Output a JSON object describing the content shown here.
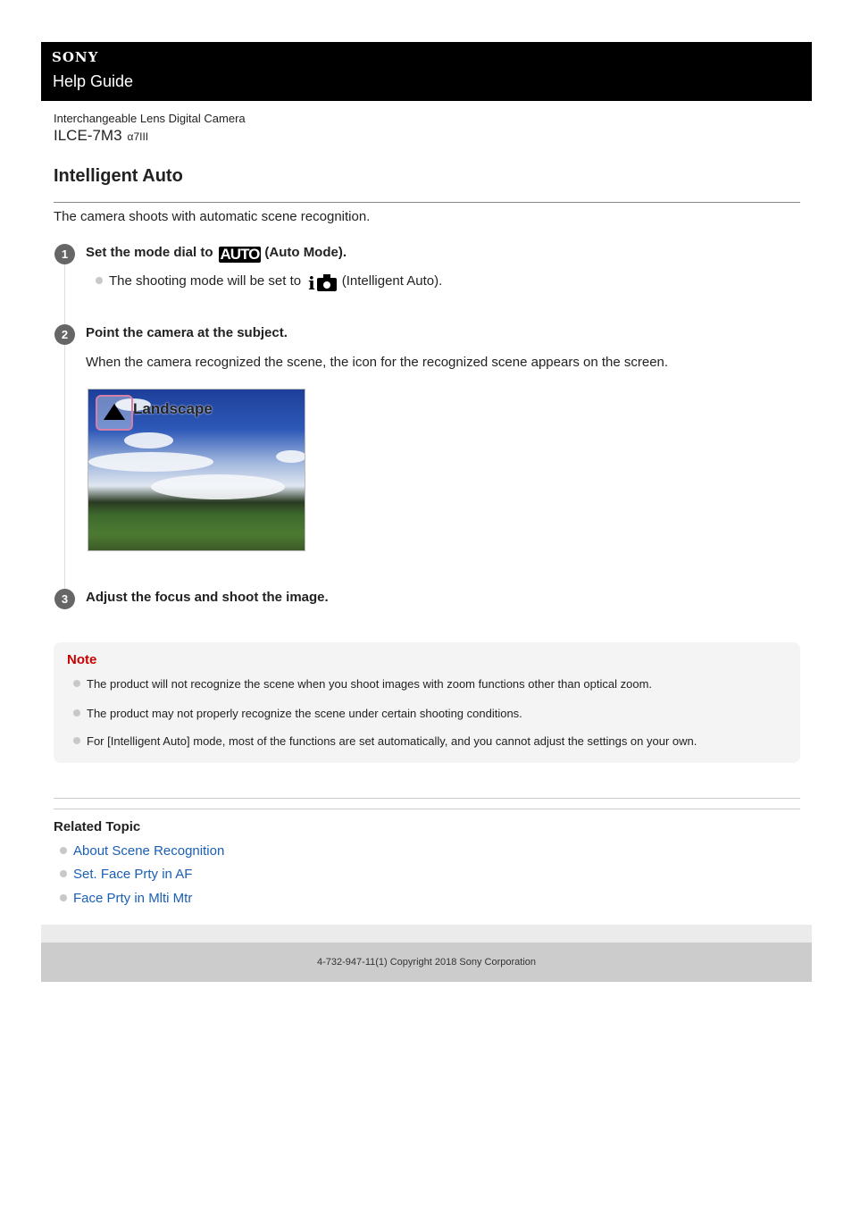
{
  "header": {
    "brand": "SONY",
    "title": "Help Guide"
  },
  "product": {
    "category": "Interchangeable Lens Digital Camera",
    "model": "ILCE-7M3",
    "alpha_name": "α7III"
  },
  "page": {
    "title": "Intelligent Auto",
    "intro": "The camera shoots with automatic scene recognition."
  },
  "steps": [
    {
      "number": "1",
      "title_before": "Set the mode dial to",
      "icon": "auto-mode-icon",
      "icon_text": "AUTO",
      "title_after": "(Auto Mode).",
      "sub_before": "The shooting mode will be set to",
      "sub_icon": "intelligent-auto-icon",
      "sub_after": "(Intelligent Auto)."
    },
    {
      "number": "2",
      "title": "Point the camera at the subject.",
      "text": "When the camera recognized the scene, the icon for the recognized scene appears on the screen.",
      "image_label": "Landscape",
      "image_icon": "landscape-mountain-icon"
    },
    {
      "number": "3",
      "title": "Adjust the focus and shoot the image."
    }
  ],
  "note": {
    "title": "Note",
    "items": [
      "The product will not recognize the scene when you shoot images with zoom functions other than optical zoom.",
      "The product may not properly recognize the scene under certain shooting conditions.",
      "For [Intelligent Auto] mode, most of the functions are set automatically, and you cannot adjust the settings on your own."
    ]
  },
  "related": {
    "title": "Related Topic",
    "links": [
      "About Scene Recognition",
      "Set. Face Prty in AF",
      "Face Prty in Mlti Mtr"
    ]
  },
  "footer": {
    "copyright": "4-732-947-11(1) Copyright 2018 Sony Corporation"
  },
  "colors": {
    "header_bg": "#000000",
    "note_title": "#cc0000",
    "link": "#1a5fb4",
    "footer_bg": "#cccccc"
  }
}
